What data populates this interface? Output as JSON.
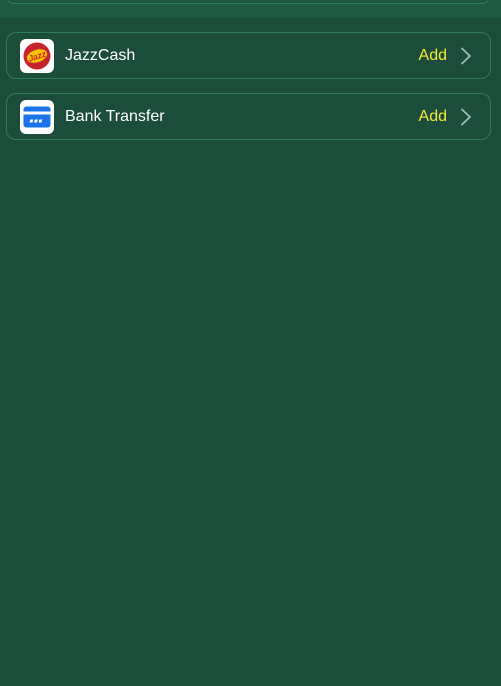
{
  "payment_methods": [
    {
      "name": "JazzCash",
      "action": "Add",
      "icon": "jazzcash-logo",
      "logo_text": "Jazz"
    },
    {
      "name": "Bank Transfer",
      "action": "Add",
      "icon": "bank-card-icon"
    }
  ],
  "colors": {
    "background": "#1b4d3a",
    "border": "#2f7a5b",
    "action": "#f2ea3a",
    "text": "#ffffff",
    "jazzcash_red": "#c8232c",
    "jazzcash_yellow": "#f5c400",
    "bank_blue": "#1a73e8"
  }
}
